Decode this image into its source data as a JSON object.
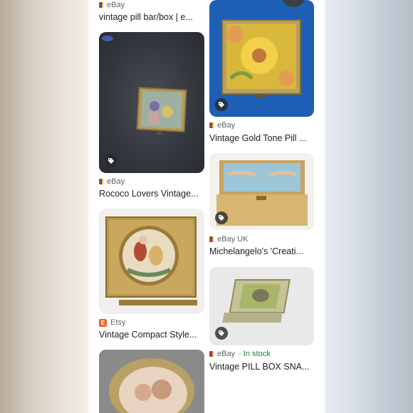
{
  "results": [
    {
      "source": "eBay",
      "title": "vintage pill bar/box | e..."
    },
    {
      "source": "eBay",
      "title": "Vintage Gold Tone Pill ..."
    },
    {
      "source": "eBay",
      "title": "Rococo Lovers Vintage..."
    },
    {
      "source": "eBay UK",
      "title": "Michelangelo's 'Creati..."
    },
    {
      "source": "Etsy",
      "title": "Vintage Compact Style..."
    },
    {
      "source": "eBay",
      "stock": "· In stock",
      "title": "Vintage PILL BOX SNA..."
    }
  ],
  "icons": {
    "tag": "shopping-tag-icon",
    "ebay": "ebay-favicon",
    "etsy": "etsy-favicon",
    "etsy_letter": "E"
  },
  "colors": {
    "in_stock": "#188038",
    "etsy": "#f1641e"
  }
}
